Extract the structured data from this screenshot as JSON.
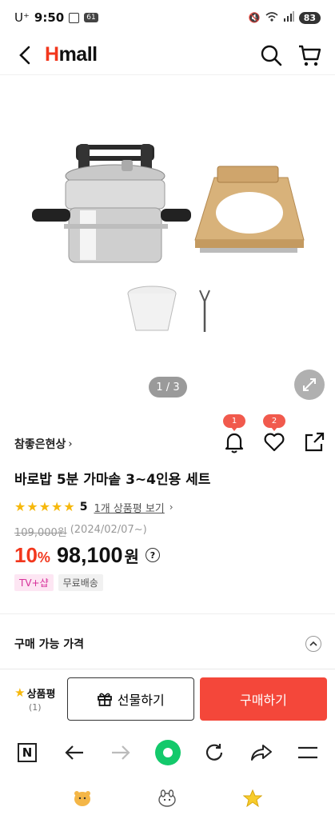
{
  "status": {
    "carrier": "U⁺",
    "time": "9:50",
    "badge": "61",
    "battery": "83"
  },
  "header": {
    "logo_h": "H",
    "logo_rest": "mall"
  },
  "image": {
    "counter": "1 / 3"
  },
  "product": {
    "brand": "참좋은현상",
    "alarm_badge": "1",
    "wish_badge": "2",
    "title": "바로밥 5분 가마솥 3~4인용 세트",
    "rating": "5",
    "review_link": "1개 상품평 보기",
    "original_price": "109,000원",
    "price_date": "(2024/02/07~)",
    "discount": "10",
    "discount_unit": "%",
    "price": "98,100",
    "won": "원",
    "tags": {
      "tv": "TV+샵",
      "shipping": "무료배송"
    }
  },
  "available": {
    "label": "구매 가능 가격"
  },
  "buy_bar": {
    "review_label": "상품평",
    "review_count": "(1)",
    "gift_label": "선물하기",
    "buy_label": "구매하기"
  },
  "colors": {
    "brand_red": "#f2371d",
    "buy_button": "#f4473a",
    "star": "#f6b80c",
    "home_green": "#13c96b"
  },
  "icons": [
    "chevron-left-icon",
    "search-icon",
    "cart-icon",
    "expand-icon",
    "bell-icon",
    "heart-icon",
    "share-icon",
    "star-icon",
    "gift-icon",
    "help-icon"
  ]
}
